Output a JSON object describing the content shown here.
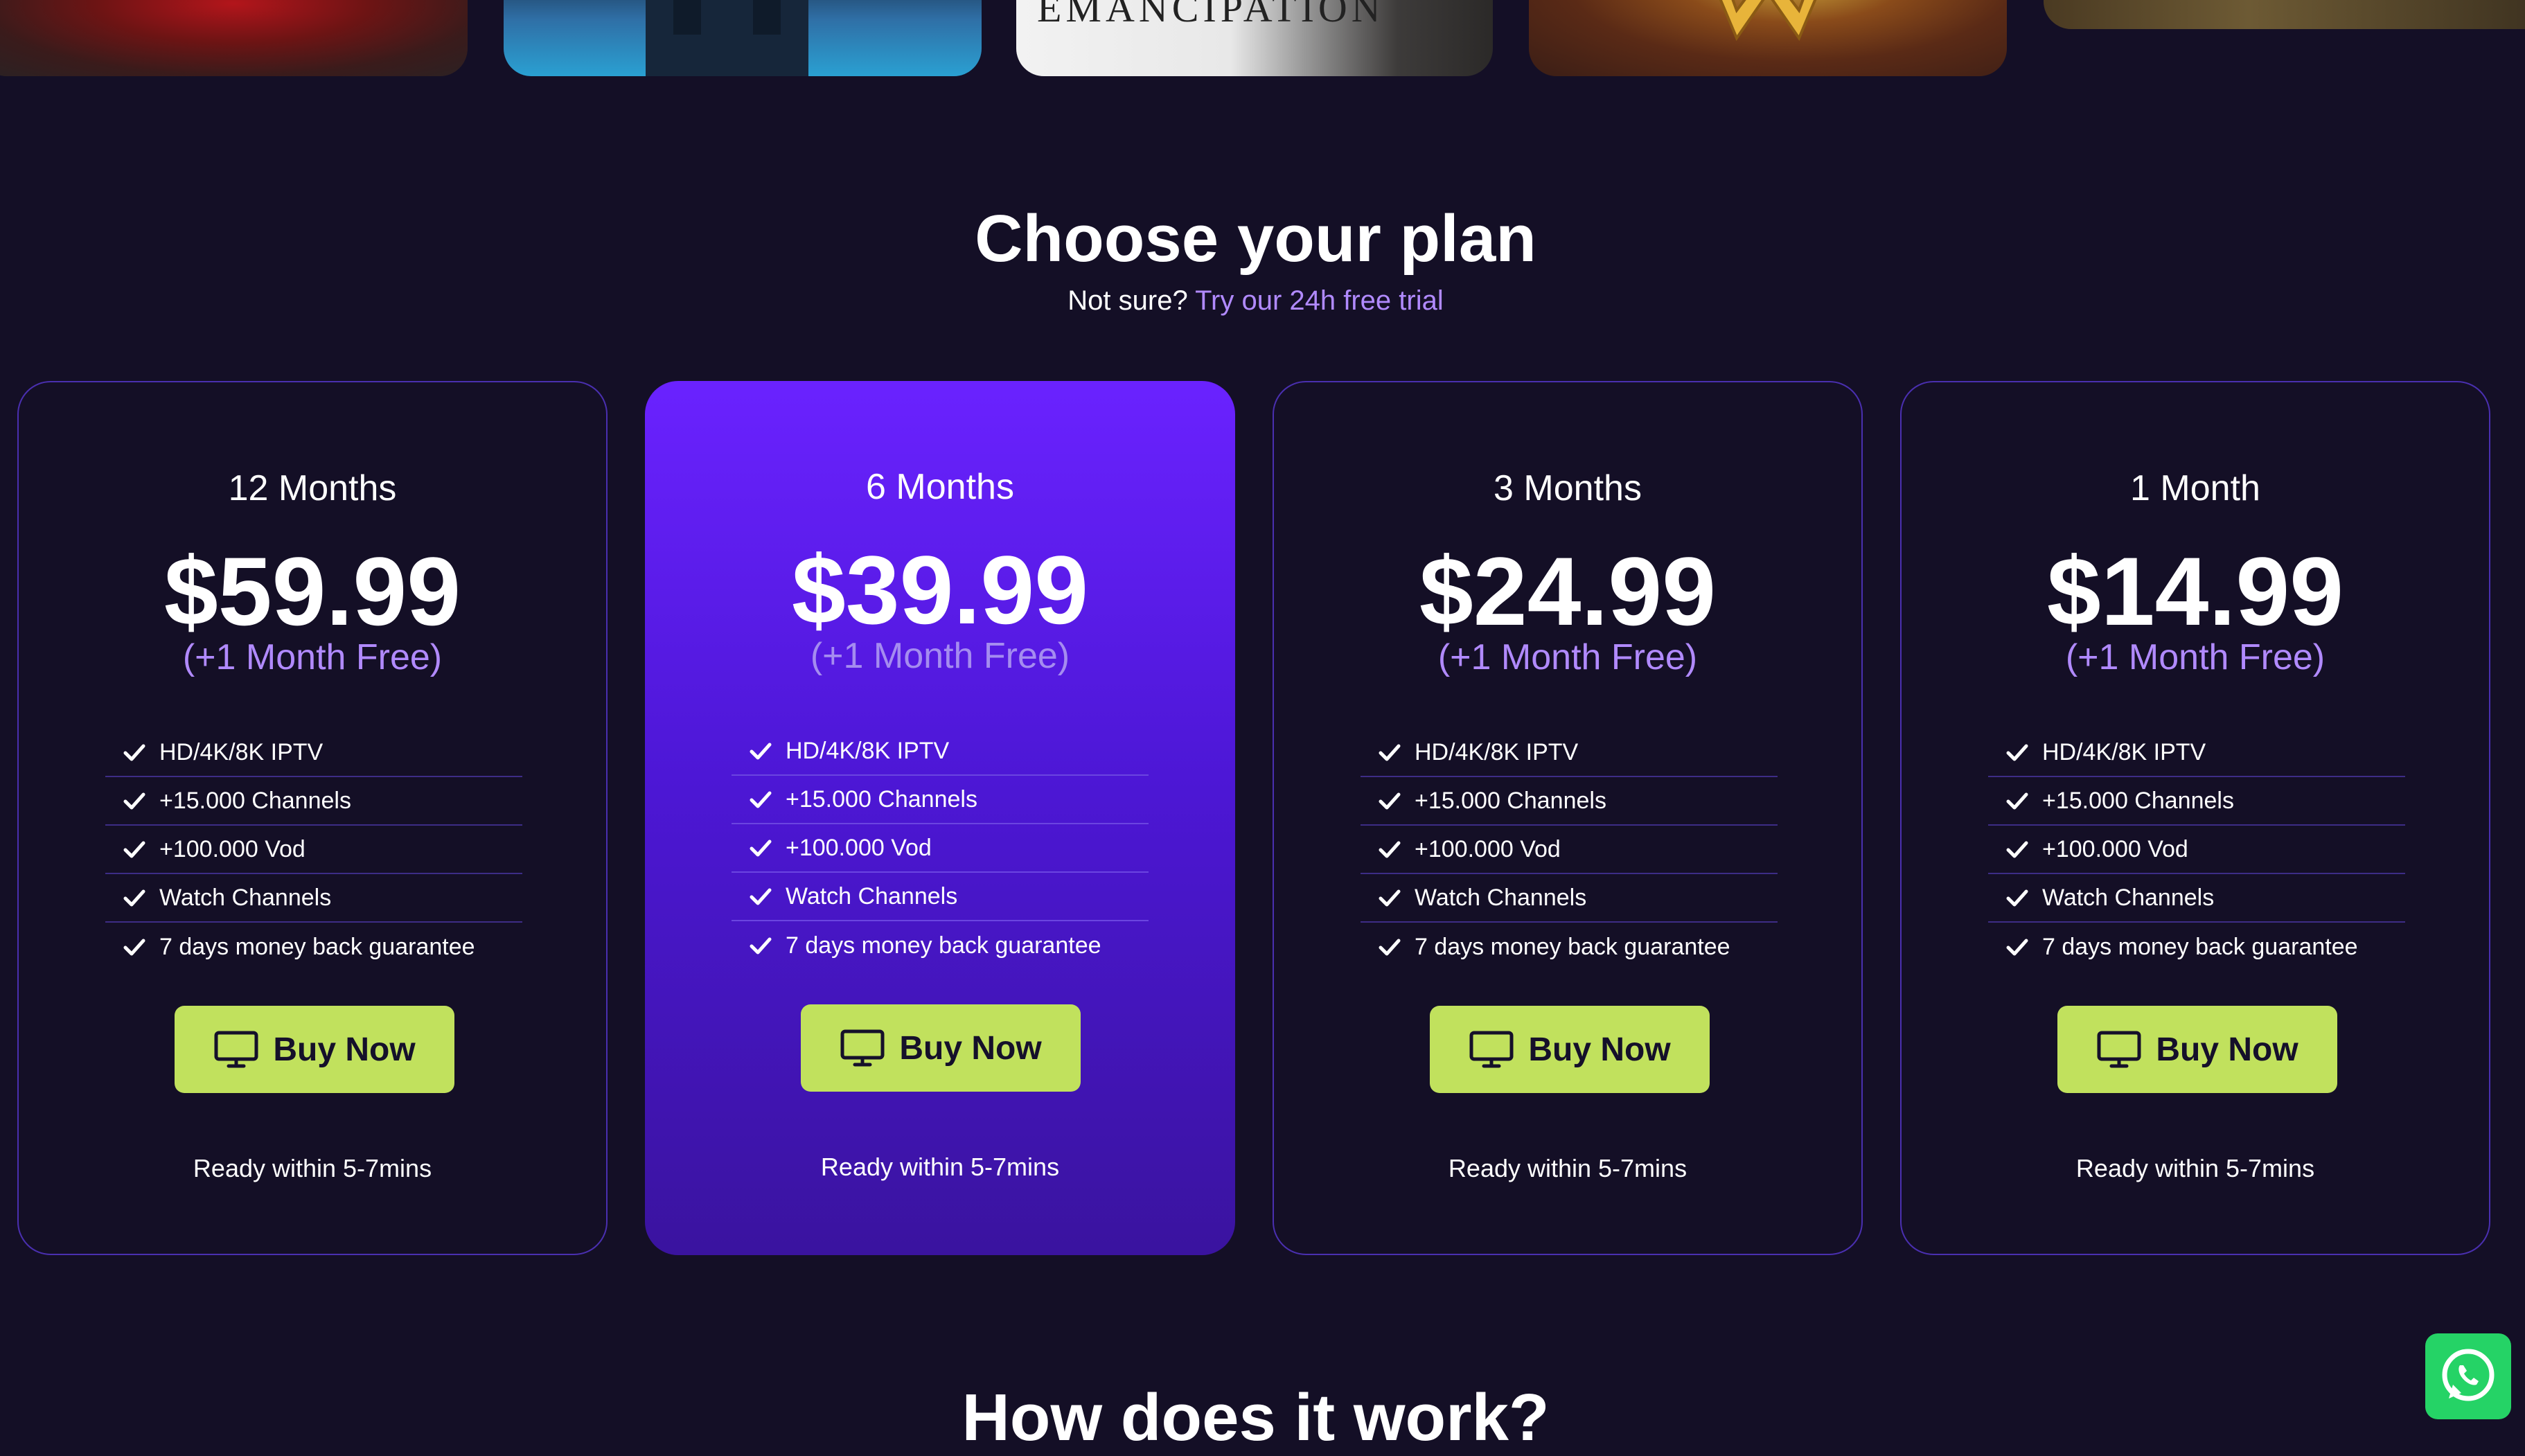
{
  "posters": {
    "poster_3_text": "EMANCIPATION"
  },
  "plans_section": {
    "title": "Choose your plan",
    "subtitle_prefix": "Not sure?",
    "subtitle_link": "Try our 24h free trial"
  },
  "plans": [
    {
      "duration": "12 Months",
      "price": "$59.99",
      "bonus": "(+1 Month Free)",
      "features": [
        "HD/4K/8K IPTV",
        "+15.000 Channels",
        "+100.000 Vod",
        "Watch Channels",
        "7 days money back guarantee"
      ],
      "button_label": "Buy Now",
      "note": "Ready within 5-7mins"
    },
    {
      "duration": "6 Months",
      "price": "$39.99",
      "bonus": "(+1 Month Free)",
      "features": [
        "HD/4K/8K IPTV",
        "+15.000 Channels",
        "+100.000 Vod",
        "Watch Channels",
        "7 days money back guarantee"
      ],
      "button_label": "Buy Now",
      "note": "Ready within 5-7mins"
    },
    {
      "duration": "3 Months",
      "price": "$24.99",
      "bonus": "(+1 Month Free)",
      "features": [
        "HD/4K/8K IPTV",
        "+15.000 Channels",
        "+100.000 Vod",
        "Watch Channels",
        "7 days money back guarantee"
      ],
      "button_label": "Buy Now",
      "note": "Ready within 5-7mins"
    },
    {
      "duration": "1 Month",
      "price": "$14.99",
      "bonus": "(+1 Month Free)",
      "features": [
        "HD/4K/8K IPTV",
        "+15.000 Channels",
        "+100.000 Vod",
        "Watch Channels",
        "7 days money back guarantee"
      ],
      "button_label": "Buy Now",
      "note": "Ready within 5-7mins"
    }
  ],
  "next_section": {
    "title": "How does it work?"
  },
  "icons": {
    "feature": "check-icon",
    "button": "monitor-icon",
    "floating": "whatsapp-icon"
  },
  "colors": {
    "background": "#140f26",
    "accent_purple": "#6a22ff",
    "link_purple": "#b18aff",
    "button_green": "#c1e15d",
    "whatsapp_green": "#25d366"
  }
}
